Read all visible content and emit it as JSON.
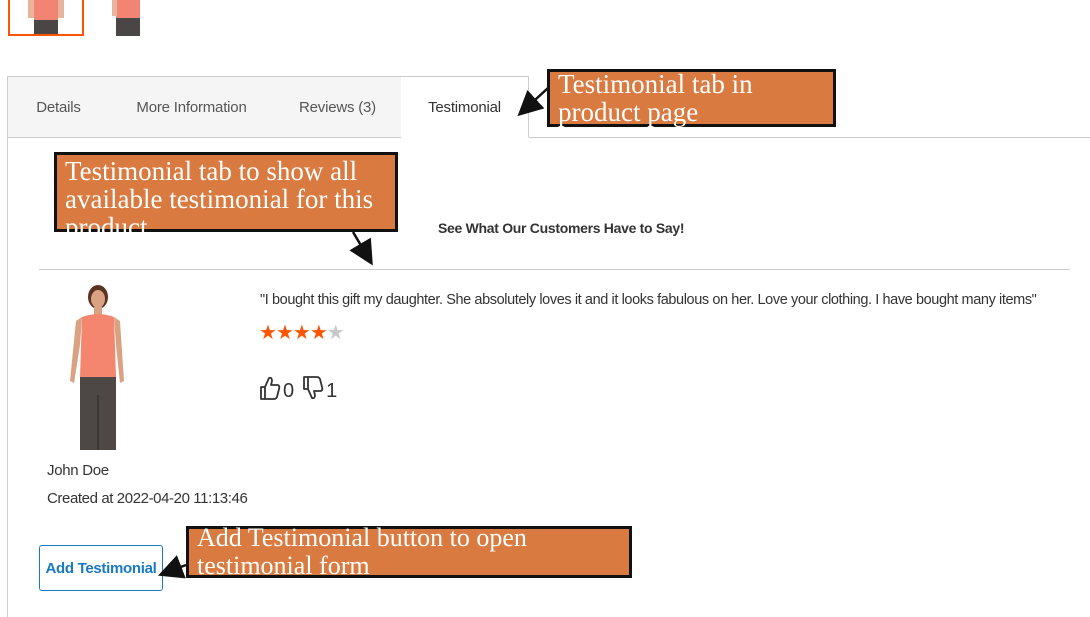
{
  "tabs": [
    {
      "label": "Details"
    },
    {
      "label": "More Information"
    },
    {
      "label": "Reviews (3)"
    },
    {
      "label": "Testimonial",
      "active": true
    }
  ],
  "testimonial_section": {
    "heading": "See What Our Customers Have to Say!",
    "item": {
      "quote": "\"I bought this gift my daughter. She absolutely loves it and it looks fabulous on her. Love your clothing. I have bought many items\"",
      "rating": 4,
      "rating_max": 5,
      "likes": "0",
      "dislikes": "1",
      "author": "John Doe",
      "created": "Created at 2022-04-20 11:13:46"
    },
    "add_button_label": "Add Testimonial"
  },
  "annotations": {
    "tab_note": "Testimonial tab in product page",
    "list_note": "Testimonial tab to show all available testimonial for this product",
    "button_note": "Add Testimonial button to open testimonial form"
  },
  "colors": {
    "accent": "#ff5501",
    "link_blue": "#1979c3",
    "callout_bg": "#d97a40"
  }
}
